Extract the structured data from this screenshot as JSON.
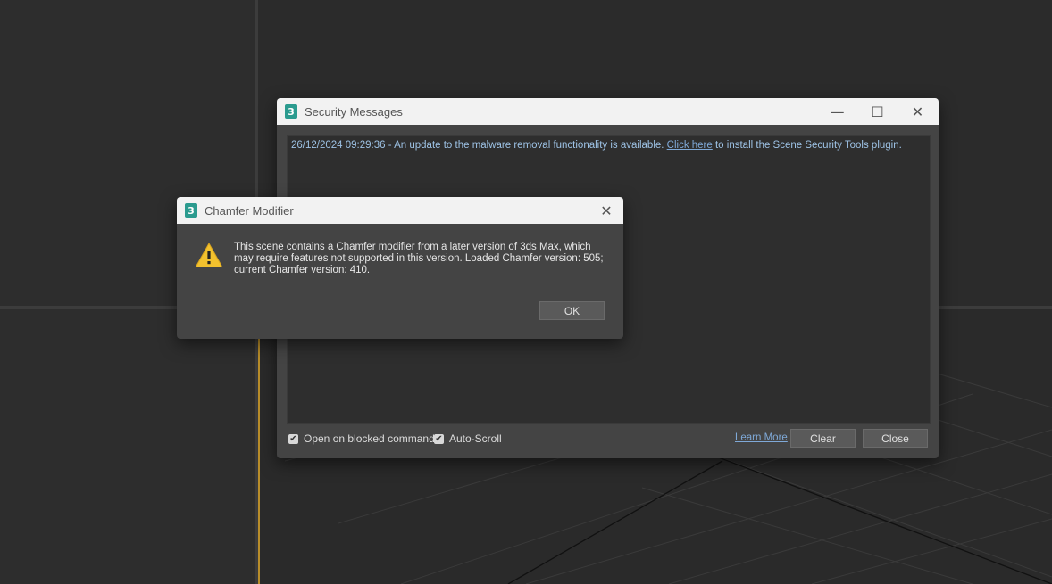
{
  "security_window": {
    "title": "Security Messages",
    "log": {
      "prefix": "26/12/2024 09:29:36 - An update to the malware removal functionality is available. ",
      "link": "Click here",
      "suffix": " to install the Scene Security Tools plugin."
    },
    "options": {
      "open_on_blocked": "Open on blocked commands",
      "auto_scroll": "Auto-Scroll"
    },
    "learn_more": "Learn More",
    "clear_label": "Clear",
    "close_label": "Close"
  },
  "chamfer_dialog": {
    "title": "Chamfer Modifier",
    "message": "This scene contains a Chamfer modifier from a later version of 3ds Max, which may require features not supported in this version. Loaded Chamfer version: 505; current Chamfer version: 410.",
    "ok_label": "OK"
  },
  "icons": {
    "app_glyph": "3",
    "minimize": "—",
    "maximize": "☐",
    "close": "✕",
    "check": "✔"
  }
}
